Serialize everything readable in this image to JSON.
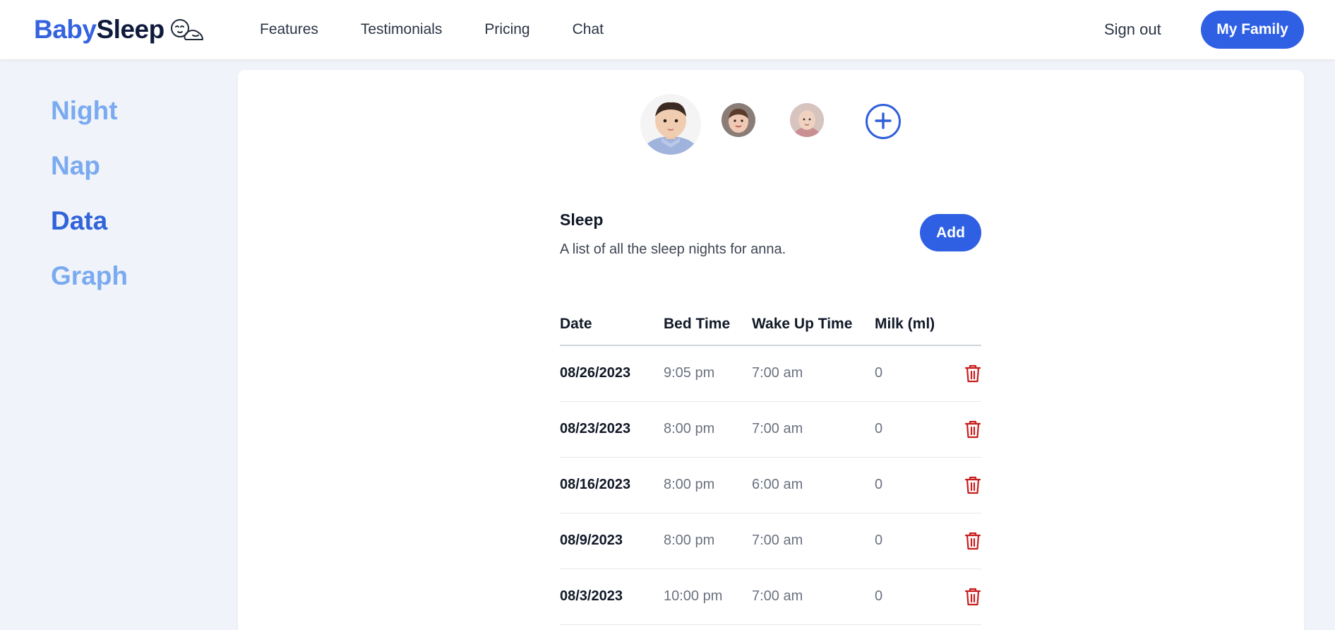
{
  "header": {
    "logo": {
      "part1": "Baby",
      "part2": "Sleep",
      "icon": "sleeping-baby-icon"
    },
    "nav": [
      {
        "label": "Features"
      },
      {
        "label": "Testimonials"
      },
      {
        "label": "Pricing"
      },
      {
        "label": "Chat"
      }
    ],
    "sign_out": "Sign out",
    "my_family": "My Family"
  },
  "sidebar": {
    "items": [
      {
        "label": "Night",
        "active": false
      },
      {
        "label": "Nap",
        "active": false
      },
      {
        "label": "Data",
        "active": true
      },
      {
        "label": "Graph",
        "active": false
      }
    ]
  },
  "children": {
    "count": 3,
    "add_icon": "plus-circle-icon"
  },
  "sleep": {
    "title": "Sleep",
    "subtitle": "A list of all the sleep nights for anna.",
    "add_label": "Add",
    "columns": [
      "Date",
      "Bed Time",
      "Wake Up Time",
      "Milk (ml)"
    ],
    "rows": [
      {
        "date": "08/26/2023",
        "bed": "9:05 pm",
        "wake": "7:00 am",
        "milk": "0"
      },
      {
        "date": "08/23/2023",
        "bed": "8:00 pm",
        "wake": "7:00 am",
        "milk": "0"
      },
      {
        "date": "08/16/2023",
        "bed": "8:00 pm",
        "wake": "6:00 am",
        "milk": "0"
      },
      {
        "date": "08/9/2023",
        "bed": "8:00 pm",
        "wake": "7:00 am",
        "milk": "0"
      },
      {
        "date": "08/3/2023",
        "bed": "10:00 pm",
        "wake": "7:00 am",
        "milk": "0"
      }
    ],
    "delete_icon": "trash-icon"
  },
  "colors": {
    "primary": "#2f60e4",
    "sidebar_inactive": "#7aaaf0",
    "sidebar_active": "#3164d9",
    "delete": "#c81e1e",
    "background": "#f0f3f9"
  }
}
